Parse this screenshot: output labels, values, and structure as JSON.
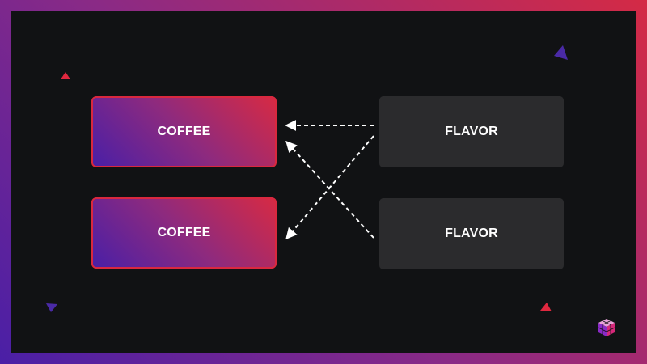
{
  "diagram": {
    "left_boxes": [
      {
        "label": "COFFEE"
      },
      {
        "label": "COFFEE"
      }
    ],
    "right_boxes": [
      {
        "label": "FLAVOR"
      },
      {
        "label": "FLAVOR"
      }
    ],
    "connections": [
      {
        "from": "right_boxes.0",
        "to": "left_boxes.0",
        "style": "dashed",
        "direction": "right-to-left"
      },
      {
        "from": "right_boxes.0",
        "to": "left_boxes.1",
        "style": "dashed",
        "direction": "right-to-left"
      },
      {
        "from": "right_boxes.1",
        "to": "left_boxes.0",
        "style": "dashed",
        "direction": "right-to-left"
      }
    ]
  },
  "colors": {
    "background": "#111214",
    "gradient_purple": "#4a1fa6",
    "gradient_magenta": "#8e2a7e",
    "gradient_red": "#d62a44",
    "flavor_box": "#2b2b2d",
    "arrow": "#ffffff"
  },
  "icons": {
    "logo": "isometric-cube-logo-icon",
    "decorations": [
      "triangle-decoration-icon"
    ]
  }
}
